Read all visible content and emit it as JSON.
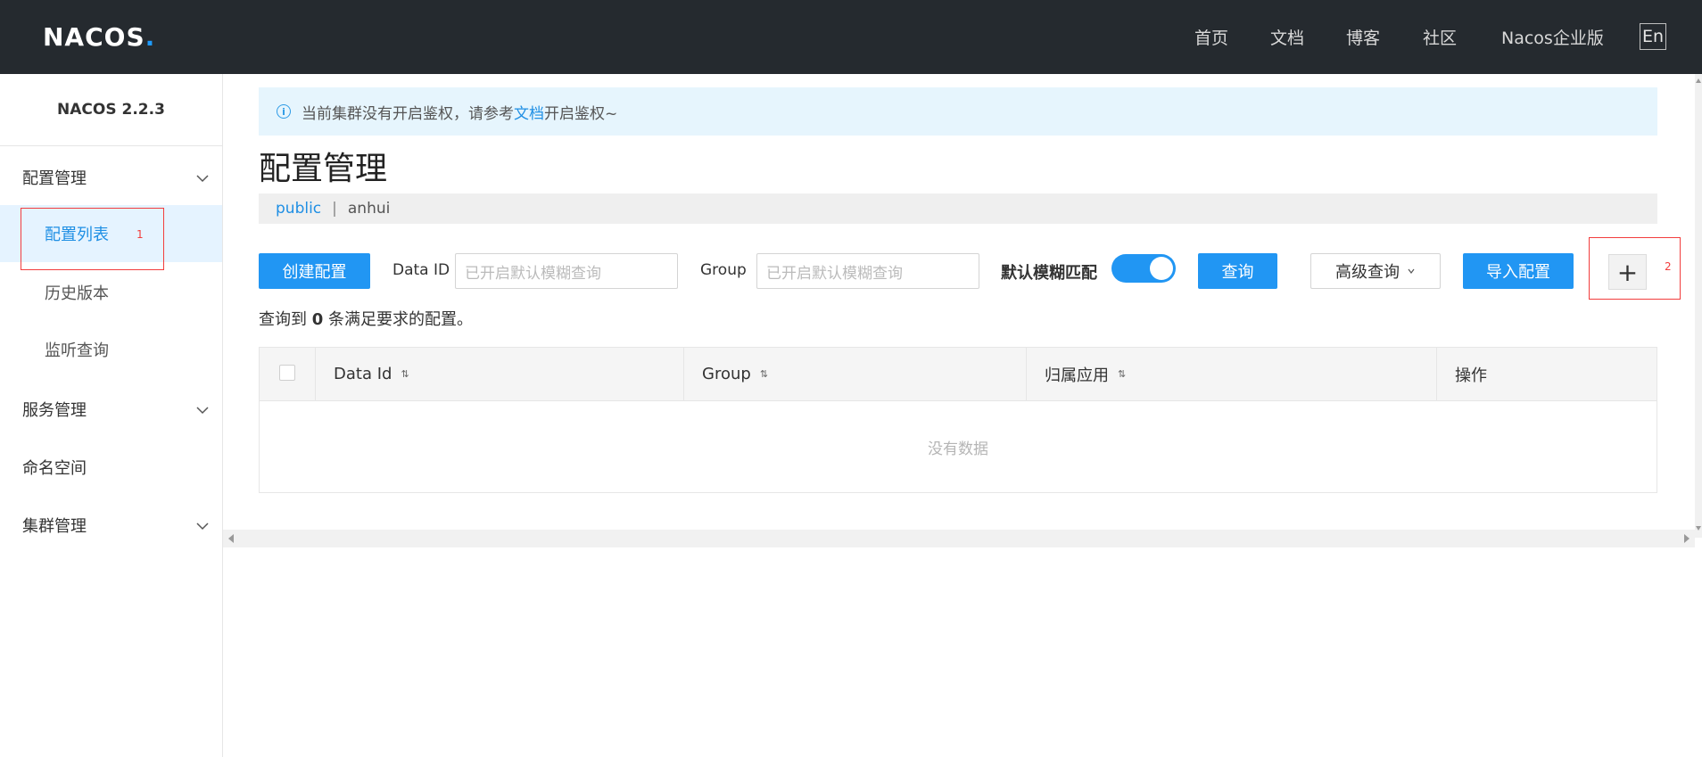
{
  "header": {
    "logo_text": "NACOS",
    "logo_dot": ".",
    "nav": [
      "首页",
      "文档",
      "博客",
      "社区",
      "Nacos企业版"
    ],
    "lang": "En"
  },
  "sidebar": {
    "version": "NACOS 2.2.3",
    "groups": [
      {
        "label": "配置管理",
        "expanded": true
      },
      {
        "label": "服务管理",
        "expanded": false
      },
      {
        "label": "命名空间"
      },
      {
        "label": "集群管理",
        "expanded": false
      }
    ],
    "config_items": [
      "配置列表",
      "历史版本",
      "监听查询"
    ],
    "active_item": "配置列表",
    "annotation_1": "1"
  },
  "alert": {
    "prefix": "当前集群没有开启鉴权，请参考",
    "link": "文档",
    "suffix": "开启鉴权~"
  },
  "page": {
    "title": "配置管理",
    "namespaces": [
      "public",
      "anhui"
    ],
    "active_namespace": "public"
  },
  "toolbar": {
    "create_button": "创建配置",
    "dataid_label": "Data ID",
    "dataid_placeholder": "已开启默认模糊查询",
    "group_label": "Group",
    "group_placeholder": "已开启默认模糊查询",
    "fuzzy_label": "默认模糊匹配",
    "fuzzy_enabled": true,
    "query_button": "查询",
    "advanced_button": "高级查询",
    "import_button": "导入配置",
    "plus_button": "+",
    "annotation_2": "2"
  },
  "result": {
    "prefix": "查询到",
    "count": "0",
    "suffix": "条满足要求的配置。"
  },
  "table": {
    "columns": [
      "Data Id",
      "Group",
      "归属应用",
      "操作"
    ],
    "empty_text": "没有数据"
  },
  "colors": {
    "topbar_bg": "#252a2f",
    "primary": "#2196f3",
    "active_bg": "#e5f3ff",
    "annotation": "#f23d3d"
  }
}
